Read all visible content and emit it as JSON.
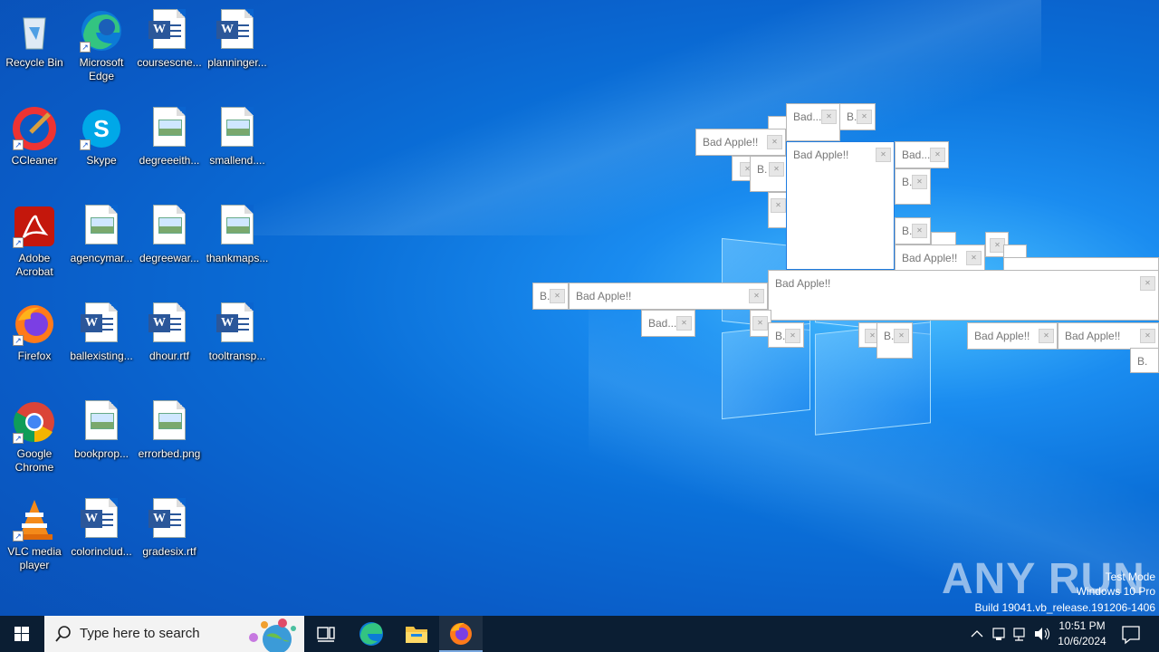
{
  "desktop": {
    "icons": [
      {
        "label": "Recycle Bin"
      },
      {
        "label": "Microsoft Edge"
      },
      {
        "label": "coursescne..."
      },
      {
        "label": "planninger..."
      },
      {
        "label": "CCleaner"
      },
      {
        "label": "Skype"
      },
      {
        "label": "degreeeith..."
      },
      {
        "label": "smallend...."
      },
      {
        "label": "Adobe Acrobat"
      },
      {
        "label": "agencymar..."
      },
      {
        "label": "degreewar..."
      },
      {
        "label": "thankmaps..."
      },
      {
        "label": "Firefox"
      },
      {
        "label": "ballexisting..."
      },
      {
        "label": "dhour.rtf"
      },
      {
        "label": "tooltransp..."
      },
      {
        "label": "Google Chrome"
      },
      {
        "label": "bookprop..."
      },
      {
        "label": "errorbed.png"
      },
      {
        "label": "VLC media player"
      },
      {
        "label": "colorinclud..."
      },
      {
        "label": "gradesix.rtf"
      }
    ]
  },
  "popups": {
    "full": "Bad Apple!!",
    "short": "Bad...",
    "tiny": "B.",
    "close_glyph": "✕"
  },
  "watermark": {
    "brand": "ANY RUN",
    "line1": "Test Mode",
    "line2": "Windows 10 Pro",
    "line3": "Build 19041.vb_release.191206-1406"
  },
  "taskbar": {
    "search_placeholder": "Type here to search",
    "time": "10:51 PM",
    "date": "10/6/2024"
  },
  "colors": {
    "taskbar": "#0b1e33",
    "accent": "#0078d7"
  }
}
